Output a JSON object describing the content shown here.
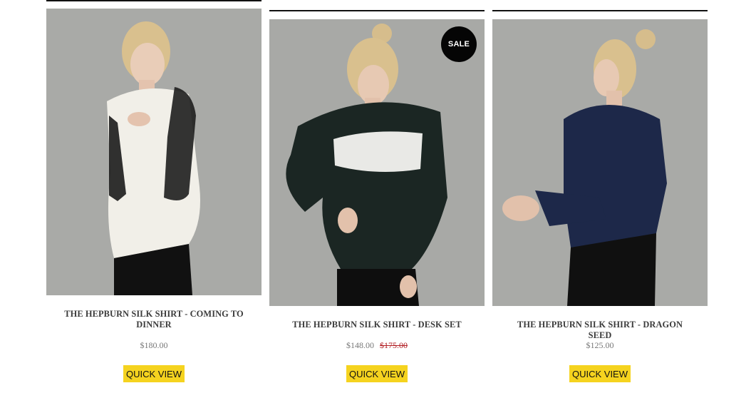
{
  "products": [
    {
      "title": "THE HEPBURN SILK SHIRT - COMING TO DINNER",
      "price": "$180.00",
      "compare_price": "",
      "badge": "",
      "button": "QUICK VIEW",
      "photo_description": "model in white silk shirt with black lace sleeves"
    },
    {
      "title": "THE HEPBURN SILK SHIRT - DESK SET",
      "price": "$148.00",
      "compare_price": "$175.00",
      "badge": "SALE",
      "button": "QUICK VIEW",
      "photo_description": "model in dark green silk shirt with white lace panel"
    },
    {
      "title": "THE HEPBURN SILK SHIRT - DRAGON SEED",
      "price": "$125.00",
      "compare_price": "",
      "badge": "",
      "button": "QUICK VIEW",
      "photo_description": "model in navy silk shirt"
    }
  ],
  "colors": {
    "button_bg": "#f5d31f",
    "sale_price": "#b21f24",
    "badge_bg": "#050505"
  }
}
